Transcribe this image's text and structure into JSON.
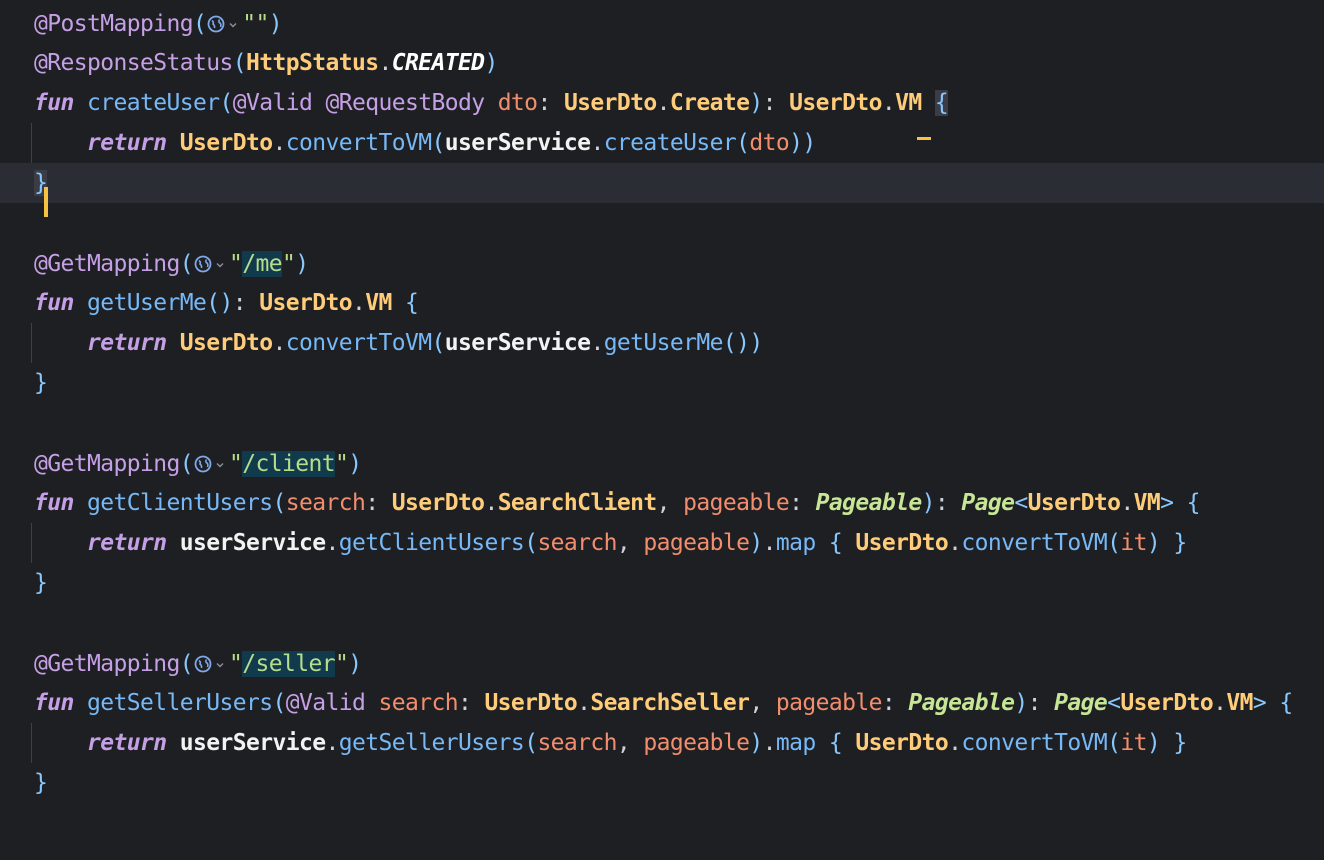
{
  "editor": {
    "lines": [
      {
        "tokens": [
          {
            "t": "@PostMapping",
            "c": "ann"
          },
          {
            "t": "(",
            "c": "paren"
          },
          {
            "icon": "globe"
          },
          {
            "t": "\"\"",
            "c": "str"
          },
          {
            "t": ")",
            "c": "paren"
          }
        ]
      },
      {
        "tokens": [
          {
            "t": "@ResponseStatus",
            "c": "ann"
          },
          {
            "t": "(",
            "c": "paren"
          },
          {
            "t": "HttpStatus",
            "c": "type"
          },
          {
            "t": ".",
            "c": "punc"
          },
          {
            "t": "CREATED",
            "c": "const"
          },
          {
            "t": ")",
            "c": "paren"
          }
        ]
      },
      {
        "tokens": [
          {
            "t": "fun",
            "c": "kw"
          },
          {
            "t": " ",
            "c": "punc"
          },
          {
            "t": "createUser",
            "c": "fn"
          },
          {
            "t": "(",
            "c": "paren"
          },
          {
            "t": "@Valid",
            "c": "ann"
          },
          {
            "t": " ",
            "c": "punc"
          },
          {
            "t": "@RequestBody",
            "c": "ann"
          },
          {
            "t": " ",
            "c": "punc"
          },
          {
            "t": "dto",
            "c": "param"
          },
          {
            "t": ": ",
            "c": "punc"
          },
          {
            "t": "UserDto",
            "c": "type"
          },
          {
            "t": ".",
            "c": "punc"
          },
          {
            "t": "Create",
            "c": "type"
          },
          {
            "t": ")",
            "c": "paren"
          },
          {
            "t": ": ",
            "c": "punc"
          },
          {
            "t": "UserDto",
            "c": "type"
          },
          {
            "t": ".",
            "c": "punc"
          },
          {
            "t": "VM",
            "c": "type"
          },
          {
            "t": " ",
            "c": "punc"
          },
          {
            "t": "{",
            "c": "bracehl"
          }
        ]
      },
      {
        "indent": true,
        "tokens": [
          {
            "t": "    ",
            "c": "punc"
          },
          {
            "t": "return",
            "c": "kw"
          },
          {
            "t": " ",
            "c": "punc"
          },
          {
            "t": "UserDto",
            "c": "type"
          },
          {
            "t": ".",
            "c": "punc"
          },
          {
            "t": "convertToVM",
            "c": "fn"
          },
          {
            "t": "(",
            "c": "paren"
          },
          {
            "t": "userService",
            "c": "var"
          },
          {
            "t": ".",
            "c": "punc"
          },
          {
            "t": "createUser",
            "c": "fn"
          },
          {
            "t": "(",
            "c": "paren"
          },
          {
            "t": "dto",
            "c": "param"
          },
          {
            "t": "))",
            "c": "paren"
          }
        ]
      },
      {
        "current": true,
        "tokens": [
          {
            "t": "}",
            "c": "bracehl"
          }
        ]
      },
      {
        "tokens": []
      },
      {
        "tokens": [
          {
            "t": "@GetMapping",
            "c": "ann"
          },
          {
            "t": "(",
            "c": "paren"
          },
          {
            "icon": "globe"
          },
          {
            "t": "\"",
            "c": "str"
          },
          {
            "t": "/me",
            "c": "strhl"
          },
          {
            "t": "\"",
            "c": "str"
          },
          {
            "t": ")",
            "c": "paren"
          }
        ]
      },
      {
        "tokens": [
          {
            "t": "fun",
            "c": "kw"
          },
          {
            "t": " ",
            "c": "punc"
          },
          {
            "t": "getUserMe",
            "c": "fn"
          },
          {
            "t": "()",
            "c": "paren"
          },
          {
            "t": ": ",
            "c": "punc"
          },
          {
            "t": "UserDto",
            "c": "type"
          },
          {
            "t": ".",
            "c": "punc"
          },
          {
            "t": "VM",
            "c": "type"
          },
          {
            "t": " ",
            "c": "punc"
          },
          {
            "t": "{",
            "c": "brace"
          }
        ]
      },
      {
        "indent": true,
        "tokens": [
          {
            "t": "    ",
            "c": "punc"
          },
          {
            "t": "return",
            "c": "kw"
          },
          {
            "t": " ",
            "c": "punc"
          },
          {
            "t": "UserDto",
            "c": "type"
          },
          {
            "t": ".",
            "c": "punc"
          },
          {
            "t": "convertToVM",
            "c": "fn"
          },
          {
            "t": "(",
            "c": "paren"
          },
          {
            "t": "userService",
            "c": "var"
          },
          {
            "t": ".",
            "c": "punc"
          },
          {
            "t": "getUserMe",
            "c": "fn"
          },
          {
            "t": "())",
            "c": "paren"
          }
        ]
      },
      {
        "tokens": [
          {
            "t": "}",
            "c": "brace"
          }
        ]
      },
      {
        "tokens": []
      },
      {
        "tokens": [
          {
            "t": "@GetMapping",
            "c": "ann"
          },
          {
            "t": "(",
            "c": "paren"
          },
          {
            "icon": "globe"
          },
          {
            "t": "\"",
            "c": "str"
          },
          {
            "t": "/client",
            "c": "strhl"
          },
          {
            "t": "\"",
            "c": "str"
          },
          {
            "t": ")",
            "c": "paren"
          }
        ]
      },
      {
        "tokens": [
          {
            "t": "fun",
            "c": "kw"
          },
          {
            "t": " ",
            "c": "punc"
          },
          {
            "t": "getClientUsers",
            "c": "fn"
          },
          {
            "t": "(",
            "c": "paren"
          },
          {
            "t": "search",
            "c": "param"
          },
          {
            "t": ": ",
            "c": "punc"
          },
          {
            "t": "UserDto",
            "c": "type"
          },
          {
            "t": ".",
            "c": "punc"
          },
          {
            "t": "SearchClient",
            "c": "type"
          },
          {
            "t": ", ",
            "c": "punc"
          },
          {
            "t": "pageable",
            "c": "param"
          },
          {
            "t": ": ",
            "c": "punc"
          },
          {
            "t": "Pageable",
            "c": "gen"
          },
          {
            "t": ")",
            "c": "paren"
          },
          {
            "t": ": ",
            "c": "punc"
          },
          {
            "t": "Page",
            "c": "gen"
          },
          {
            "t": "<",
            "c": "paren"
          },
          {
            "t": "UserDto",
            "c": "type"
          },
          {
            "t": ".",
            "c": "punc"
          },
          {
            "t": "VM",
            "c": "type"
          },
          {
            "t": ">",
            "c": "paren"
          },
          {
            "t": " ",
            "c": "punc"
          },
          {
            "t": "{",
            "c": "brace"
          }
        ]
      },
      {
        "indent": true,
        "tokens": [
          {
            "t": "    ",
            "c": "punc"
          },
          {
            "t": "return",
            "c": "kw"
          },
          {
            "t": " ",
            "c": "punc"
          },
          {
            "t": "userService",
            "c": "var"
          },
          {
            "t": ".",
            "c": "punc"
          },
          {
            "t": "getClientUsers",
            "c": "fn"
          },
          {
            "t": "(",
            "c": "paren"
          },
          {
            "t": "search",
            "c": "param"
          },
          {
            "t": ", ",
            "c": "punc"
          },
          {
            "t": "pageable",
            "c": "param"
          },
          {
            "t": ")",
            "c": "paren"
          },
          {
            "t": ".",
            "c": "punc"
          },
          {
            "t": "map",
            "c": "fn"
          },
          {
            "t": " ",
            "c": "punc"
          },
          {
            "t": "{",
            "c": "brace"
          },
          {
            "t": " ",
            "c": "punc"
          },
          {
            "t": "UserDto",
            "c": "type"
          },
          {
            "t": ".",
            "c": "punc"
          },
          {
            "t": "convertToVM",
            "c": "fn"
          },
          {
            "t": "(",
            "c": "paren"
          },
          {
            "t": "it",
            "c": "it"
          },
          {
            "t": ")",
            "c": "paren"
          },
          {
            "t": " ",
            "c": "punc"
          },
          {
            "t": "}",
            "c": "brace"
          }
        ]
      },
      {
        "tokens": [
          {
            "t": "}",
            "c": "brace"
          }
        ]
      },
      {
        "tokens": []
      },
      {
        "tokens": [
          {
            "t": "@GetMapping",
            "c": "ann"
          },
          {
            "t": "(",
            "c": "paren"
          },
          {
            "icon": "globe"
          },
          {
            "t": "\"",
            "c": "str"
          },
          {
            "t": "/seller",
            "c": "strhl"
          },
          {
            "t": "\"",
            "c": "str"
          },
          {
            "t": ")",
            "c": "paren"
          }
        ]
      },
      {
        "tokens": [
          {
            "t": "fun",
            "c": "kw"
          },
          {
            "t": " ",
            "c": "punc"
          },
          {
            "t": "getSellerUsers",
            "c": "fn"
          },
          {
            "t": "(",
            "c": "paren"
          },
          {
            "t": "@Valid",
            "c": "ann"
          },
          {
            "t": " ",
            "c": "punc"
          },
          {
            "t": "search",
            "c": "param"
          },
          {
            "t": ": ",
            "c": "punc"
          },
          {
            "t": "UserDto",
            "c": "type"
          },
          {
            "t": ".",
            "c": "punc"
          },
          {
            "t": "SearchSeller",
            "c": "type"
          },
          {
            "t": ", ",
            "c": "punc"
          },
          {
            "t": "pageable",
            "c": "param"
          },
          {
            "t": ": ",
            "c": "punc"
          },
          {
            "t": "Pageable",
            "c": "gen"
          },
          {
            "t": ")",
            "c": "paren"
          },
          {
            "t": ": ",
            "c": "punc"
          },
          {
            "t": "Page",
            "c": "gen"
          },
          {
            "t": "<",
            "c": "paren"
          },
          {
            "t": "UserDto",
            "c": "type"
          },
          {
            "t": ".",
            "c": "punc"
          },
          {
            "t": "VM",
            "c": "type"
          },
          {
            "t": ">",
            "c": "paren"
          },
          {
            "t": " ",
            "c": "punc"
          },
          {
            "t": "{",
            "c": "brace"
          }
        ]
      },
      {
        "indent": true,
        "tokens": [
          {
            "t": "    ",
            "c": "punc"
          },
          {
            "t": "return",
            "c": "kw"
          },
          {
            "t": " ",
            "c": "punc"
          },
          {
            "t": "userService",
            "c": "var"
          },
          {
            "t": ".",
            "c": "punc"
          },
          {
            "t": "getSellerUsers",
            "c": "fn"
          },
          {
            "t": "(",
            "c": "paren"
          },
          {
            "t": "search",
            "c": "param"
          },
          {
            "t": ", ",
            "c": "punc"
          },
          {
            "t": "pageable",
            "c": "param"
          },
          {
            "t": ")",
            "c": "paren"
          },
          {
            "t": ".",
            "c": "punc"
          },
          {
            "t": "map",
            "c": "fn"
          },
          {
            "t": " ",
            "c": "punc"
          },
          {
            "t": "{",
            "c": "brace"
          },
          {
            "t": " ",
            "c": "punc"
          },
          {
            "t": "UserDto",
            "c": "type"
          },
          {
            "t": ".",
            "c": "punc"
          },
          {
            "t": "convertToVM",
            "c": "fn"
          },
          {
            "t": "(",
            "c": "paren"
          },
          {
            "t": "it",
            "c": "it"
          },
          {
            "t": ")",
            "c": "paren"
          },
          {
            "t": " ",
            "c": "punc"
          },
          {
            "t": "}",
            "c": "brace"
          }
        ]
      },
      {
        "tokens": [
          {
            "t": "}",
            "c": "brace"
          }
        ]
      }
    ]
  },
  "colors": {
    "background": "#1e1f22",
    "current_line": "#2a2d33",
    "caret": "#f5c242"
  }
}
